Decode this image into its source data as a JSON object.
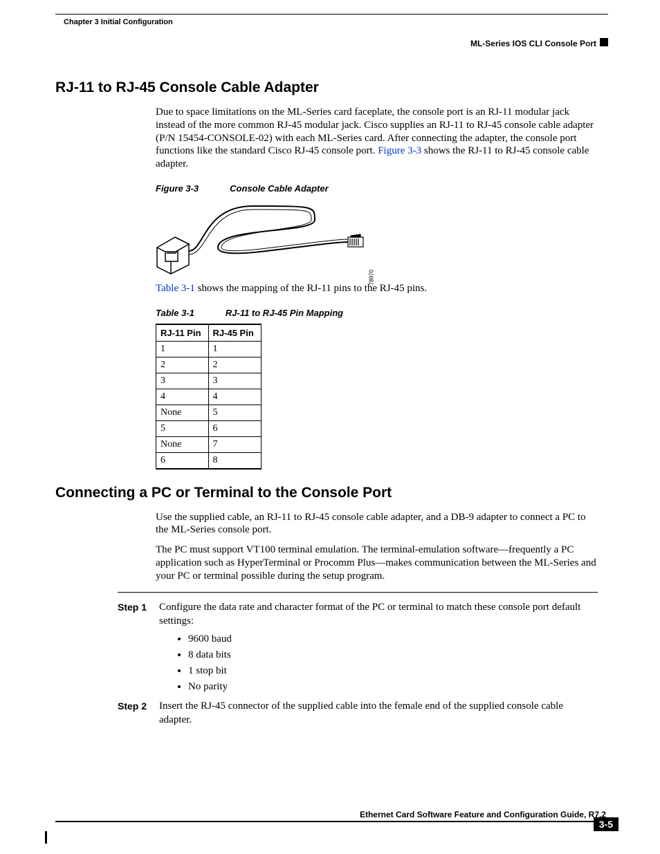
{
  "header": {
    "chapter": "Chapter 3    Initial Configuration",
    "section": "ML-Series IOS CLI Console Port"
  },
  "s1": {
    "heading": "RJ-11 to RJ-45 Console Cable Adapter",
    "p1a": "Due to space limitations on the ML-Series card faceplate, the console port is an RJ-11 modular jack instead of the more common RJ-45 modular jack. Cisco supplies an RJ-11 to RJ-45 console cable adapter (P/N 15454-CONSOLE-02) with each ML-Series card. After connecting the adapter, the console port functions like the standard Cisco RJ-45 console port. ",
    "p1link": "Figure 3-3",
    "p1b": " shows the RJ-11 to RJ-45 console cable adapter.",
    "fig_caption_num": "Figure 3-3",
    "fig_caption_title": "Console Cable Adapter",
    "fig_id": "78970",
    "p2link": "Table 3-1",
    "p2": " shows the mapping of the RJ-11 pins to the RJ-45 pins.",
    "tbl_caption_num": "Table 3-1",
    "tbl_caption_title": "RJ-11 to RJ-45 Pin Mapping",
    "tbl_h1": "RJ-11 Pin",
    "tbl_h2": "RJ-45 Pin",
    "rows": [
      {
        "a": "1",
        "b": "1"
      },
      {
        "a": "2",
        "b": "2"
      },
      {
        "a": "3",
        "b": "3"
      },
      {
        "a": "4",
        "b": "4"
      },
      {
        "a": "None",
        "b": "5"
      },
      {
        "a": "5",
        "b": "6"
      },
      {
        "a": "None",
        "b": "7"
      },
      {
        "a": "6",
        "b": "8"
      }
    ]
  },
  "s2": {
    "heading": "Connecting a PC or Terminal to the Console Port",
    "p1": "Use the supplied cable, an RJ-11 to RJ-45 console cable adapter, and a DB-9 adapter to connect a PC to the ML-Series console port.",
    "p2": "The PC must support VT100 terminal emulation. The terminal-emulation software—frequently a PC application such as HyperTerminal or Procomm Plus—makes communication between the ML-Series and your PC or terminal possible during the setup program.",
    "step1_label": "Step 1",
    "step1_body": "Configure the data rate and character format of the PC or terminal to match these console port default settings:",
    "bullets": [
      "9600 baud",
      "8 data bits",
      "1 stop bit",
      "No parity"
    ],
    "step2_label": "Step 2",
    "step2_body": "Insert the RJ-45 connector of the supplied cable into the female end of the supplied console cable adapter."
  },
  "footer": {
    "title": "Ethernet Card Software Feature and Configuration Guide, R7.2",
    "page": "3-5"
  }
}
